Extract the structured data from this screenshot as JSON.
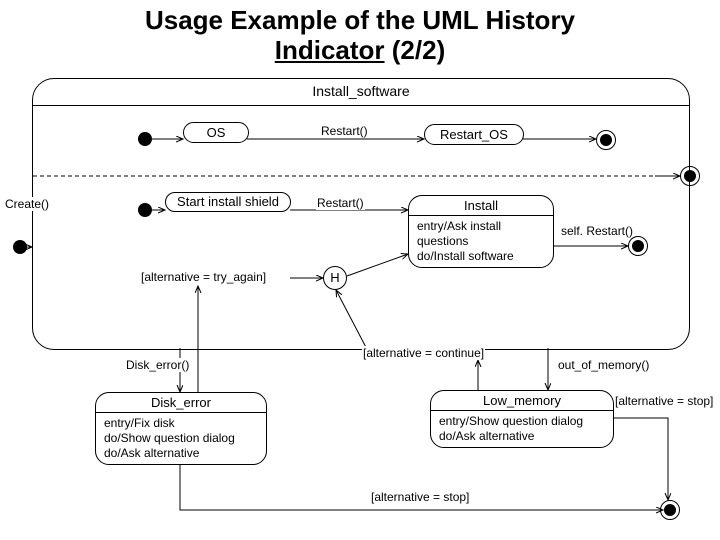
{
  "title_pre": "Usage Example of the UML History ",
  "title_u": "Indicator",
  "title_post": " (2/2)",
  "outer": "Install_software",
  "create": "Create()",
  "os": "OS",
  "restart1": "Restart()",
  "restart_os": "Restart_OS",
  "sis": "Start install shield",
  "restart2": "Restart()",
  "install_title": "Install",
  "install_body1": "entry/Ask install questions",
  "install_body2": "do/Install software",
  "self_restart": "self. Restart()",
  "alt_try": "[alternative = try_again]",
  "history": "H",
  "disk_error_evt": "Disk_error()",
  "alt_continue": "[alternative = continue]",
  "oom_evt": "out_of_memory()",
  "disk_error_title": "Disk_error",
  "disk_body1": "entry/Fix disk",
  "disk_body2": "do/Show question dialog",
  "disk_body3": "do/Ask alternative",
  "low_mem_title": "Low_memory",
  "low_body1": "entry/Show question dialog",
  "low_body2": "do/Ask alternative",
  "alt_stop": "[alternative = stop]"
}
